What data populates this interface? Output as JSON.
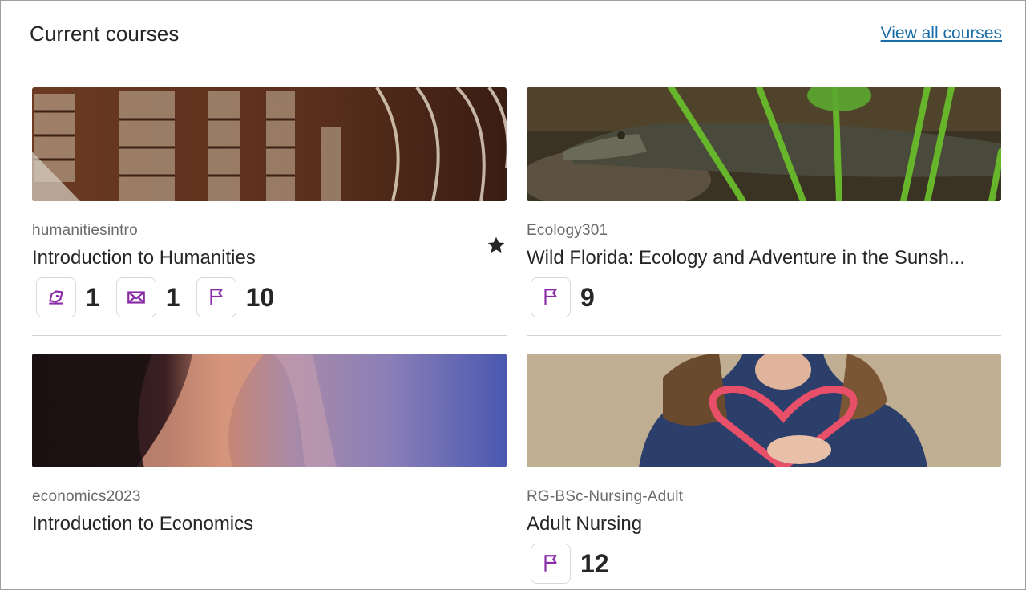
{
  "header": {
    "title": "Current courses",
    "view_all_label": "View all courses"
  },
  "colors": {
    "accent_purple": "#8a2ba8",
    "link_blue": "#1a6ea8"
  },
  "courses": [
    {
      "code": "humanitiesintro",
      "title": "Introduction to Humanities",
      "favorited": true,
      "image": "library-bookshelves",
      "stats": [
        {
          "icon": "edit-assignment-icon",
          "count": "1"
        },
        {
          "icon": "envelope-icon",
          "count": "1"
        },
        {
          "icon": "flag-icon",
          "count": "10"
        }
      ]
    },
    {
      "code": "Ecology301",
      "title": "Wild Florida: Ecology and Adventure in the Sunsh...",
      "favorited": false,
      "image": "alligator-in-reeds",
      "stats": [
        {
          "icon": "flag-icon",
          "count": "9"
        }
      ]
    },
    {
      "code": "economics2023",
      "title": "Introduction to Economics",
      "favorited": false,
      "image": "canyon-sandstone",
      "stats": []
    },
    {
      "code": "RG-BSc-Nursing-Adult",
      "title": "Adult Nursing",
      "favorited": false,
      "image": "child-holding-heart",
      "stats": [
        {
          "icon": "flag-icon",
          "count": "12"
        }
      ]
    }
  ]
}
